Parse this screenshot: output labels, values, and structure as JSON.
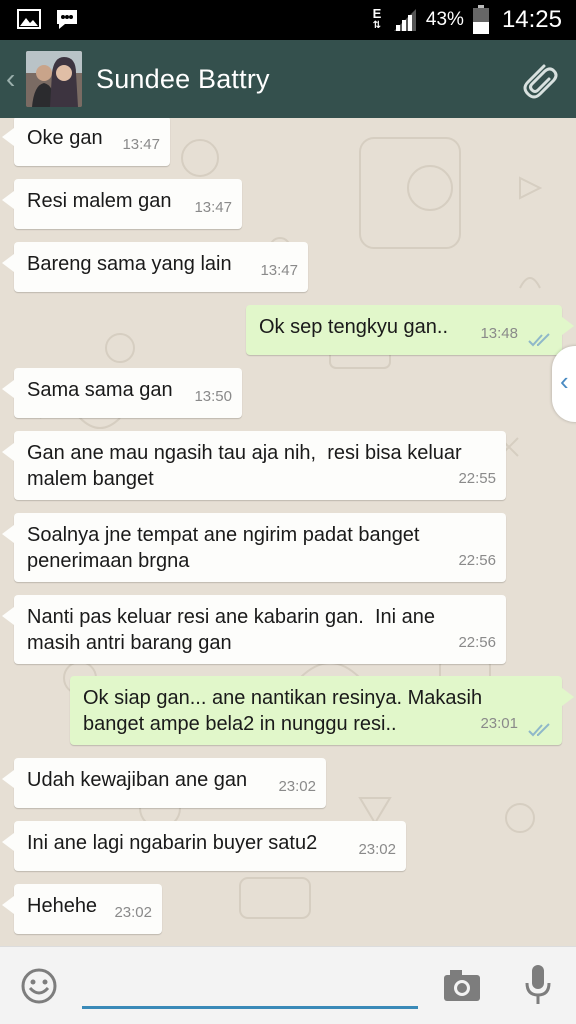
{
  "status_bar": {
    "network_type": "E",
    "battery_percent": "43%",
    "time": "14:25",
    "icons": [
      "gallery-icon",
      "bbm-icon",
      "signal-icon",
      "battery-icon"
    ]
  },
  "header": {
    "contact_name": "Sundee Battry",
    "back_icon": "chevron-left-icon",
    "attach_icon": "paperclip-icon"
  },
  "messages": [
    {
      "direction": "in",
      "text": "Oke gan",
      "time": "13:47"
    },
    {
      "direction": "in",
      "text": "Resi malem gan",
      "time": "13:47"
    },
    {
      "direction": "in",
      "text": "Bareng sama yang lain",
      "time": "13:47"
    },
    {
      "direction": "out",
      "text": "Ok sep tengkyu gan..",
      "time": "13:48",
      "status": "read"
    },
    {
      "direction": "in",
      "text": "Sama sama gan",
      "time": "13:50"
    },
    {
      "direction": "in",
      "text": "Gan ane mau ngasih tau aja nih,  resi bisa keluar\nmalem banget",
      "time": "22:55"
    },
    {
      "direction": "in",
      "text": "Soalnya jne tempat ane ngirim padat banget\npenerimaan brgna",
      "time": "22:56"
    },
    {
      "direction": "in",
      "text": "Nanti pas keluar resi ane kabarin gan.  Ini ane\nmasih antri barang gan",
      "time": "22:56"
    },
    {
      "direction": "out",
      "text": "Ok siap gan... ane nantikan resinya. Makasih\nbanget ampe bela2 in nunggu resi..",
      "time": "23:01",
      "status": "read"
    },
    {
      "direction": "in",
      "text": "Udah kewajiban ane gan",
      "time": "23:02"
    },
    {
      "direction": "in",
      "text": "Ini ane lagi ngabarin buyer satu2",
      "time": "23:02"
    },
    {
      "direction": "in",
      "text": "Hehehe",
      "time": "23:02"
    }
  ],
  "input": {
    "value": "",
    "placeholder": "",
    "icons": [
      "emoji-icon",
      "camera-icon",
      "microphone-icon"
    ]
  },
  "colors": {
    "header": "#34504d",
    "outgoing_bubble": "#e1f7ca",
    "incoming_bubble": "#fdfdfb",
    "chat_background": "#e6dfd4",
    "input_underline": "#3a8ab8",
    "read_ticks": "#8fb8c9"
  }
}
